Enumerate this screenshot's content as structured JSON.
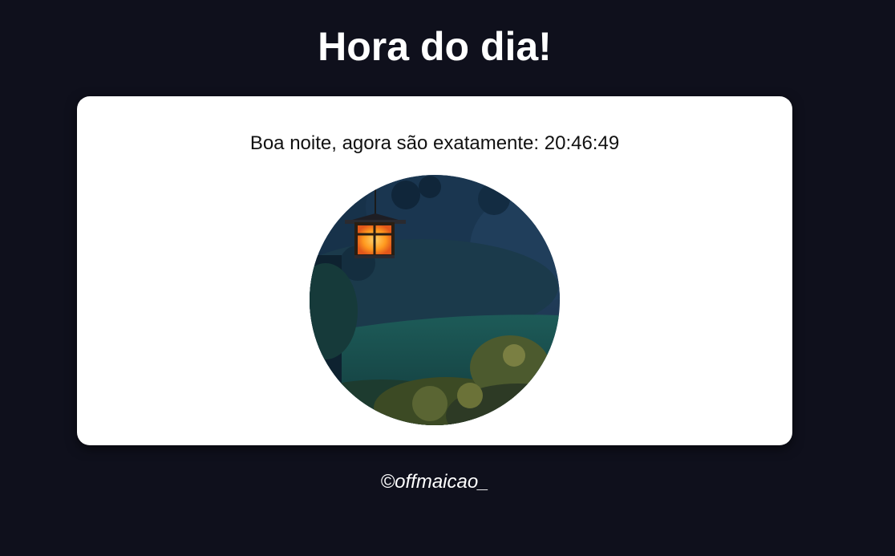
{
  "page": {
    "title": "Hora do dia!"
  },
  "card": {
    "message": "Boa noite, agora são exatamente: 20:46:49",
    "image": {
      "icon": "night-garden-lantern-photo",
      "shape": "circle"
    }
  },
  "footer": {
    "credit": "©offmaicao_"
  },
  "colors": {
    "background": "#0f101c",
    "card": "#ffffff",
    "text_dark": "#111111",
    "text_light": "#ffffff",
    "lantern_glow": "#ff9a1f"
  }
}
